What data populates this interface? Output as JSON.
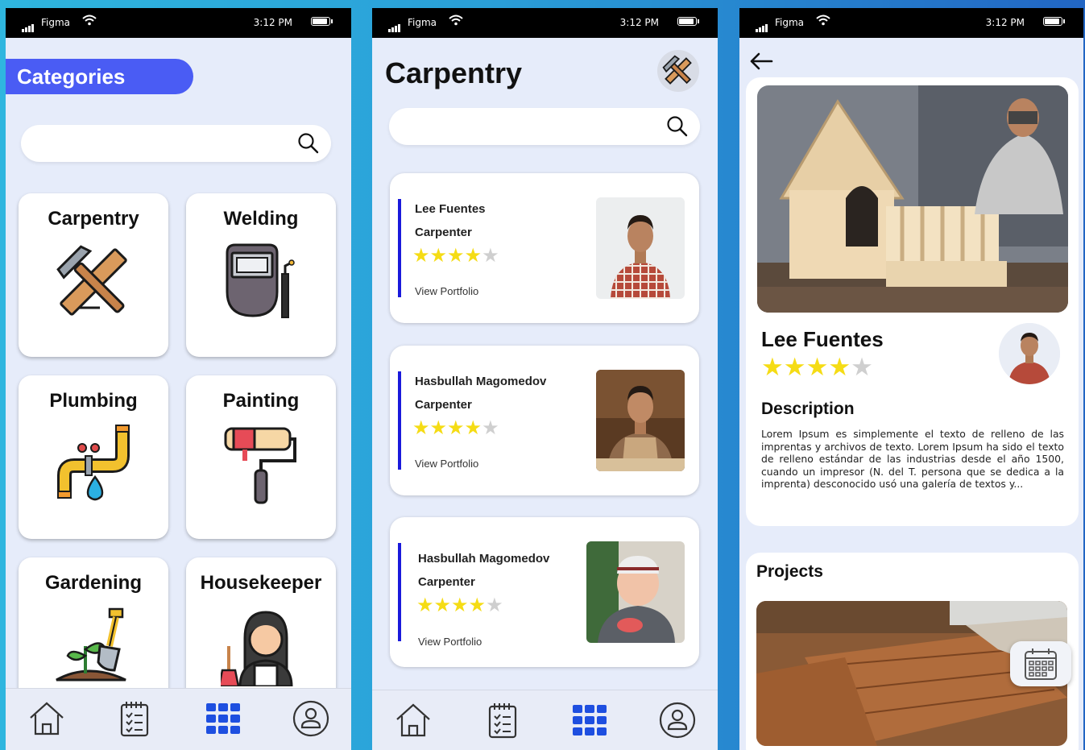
{
  "status": {
    "carrier": "Figma",
    "time": "3:12 PM"
  },
  "screen1": {
    "header": "Categories",
    "categories": [
      {
        "label": "Carpentry",
        "icon": "hammer-saw-icon"
      },
      {
        "label": "Welding",
        "icon": "welding-mask-icon"
      },
      {
        "label": "Plumbing",
        "icon": "pipe-icon"
      },
      {
        "label": "Painting",
        "icon": "paint-roller-icon"
      },
      {
        "label": "Gardening",
        "icon": "plant-shovel-icon"
      },
      {
        "label": "Housekeeper",
        "icon": "housekeeper-icon"
      }
    ]
  },
  "screen2": {
    "title": "Carpentry",
    "workers": [
      {
        "name": "Lee Fuentes",
        "role": "Carpenter",
        "rating": 4,
        "link": "View Portfolio"
      },
      {
        "name": "Hasbullah Magomedov",
        "role": "Carpenter",
        "rating": 4,
        "link": "View Portfolio"
      },
      {
        "name": "Hasbullah Magomedov",
        "role": "Carpenter",
        "rating": 4,
        "link": "View Portfolio"
      }
    ]
  },
  "screen3": {
    "name": "Lee Fuentes",
    "rating": 4,
    "description_title": "Description",
    "description": "Lorem Ipsum es simplemente el texto de relleno de las imprentas y archivos de texto. Lorem Ipsum ha sido el texto de relleno estándar de las industrias desde el año 1500, cuando un impresor (N. del T. persona que se dedica a la imprenta) desconocido usó una galería de textos y...",
    "projects_title": "Projects"
  },
  "nav": [
    {
      "icon": "home-icon"
    },
    {
      "icon": "checklist-icon"
    },
    {
      "icon": "grid-icon"
    },
    {
      "icon": "profile-icon"
    }
  ],
  "colors": {
    "accent": "#4a5cf4",
    "star": "#f5dc15",
    "card_bar": "#1a1adb",
    "screen_bg": "#e6ecfa"
  }
}
